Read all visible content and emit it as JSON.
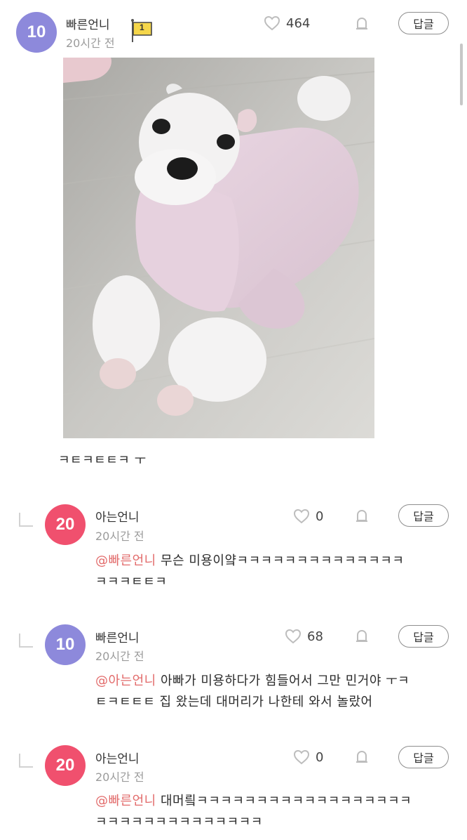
{
  "post": {
    "level": "10",
    "nickname": "빠른언니",
    "time": "20시간 전",
    "flag_badge": "1",
    "likes": "464",
    "reply_label": "답글",
    "text": "ㅋㅌㅋㅌㅌㅋ ㅜ"
  },
  "comments": [
    {
      "level": "20",
      "nickname": "아는언니",
      "time": "20시간 전",
      "likes": "0",
      "reply_label": "답글",
      "mention": "@빠른언니",
      "line1": " 무슨 미용이얔ㅋㅋㅋㅋㅋㅋㅋㅋㅋㅋㅋㅋㅋㅋ",
      "line2": "ㅋㅋㅋㅌㅌㅋ"
    },
    {
      "level": "10",
      "nickname": "빠른언니",
      "time": "20시간 전",
      "likes": "68",
      "reply_label": "답글",
      "mention": "@아는언니",
      "line1": " 아빠가 미용하다가 힘들어서 그만 민거야 ㅜㅋ",
      "line2": "ㅌㅋㅌㅌㅌ 집 왔는데 대머리가 나한테 와서 놀랐어"
    },
    {
      "level": "20",
      "nickname": "아는언니",
      "time": "20시간 전",
      "likes": "0",
      "reply_label": "답글",
      "mention": "@빠른언니",
      "line1": " 대머릨ㅋㅋㅋㅋㅋㅋㅋㅋㅋㅋㅋㅋㅋㅋㅋㅋㅋㅋ",
      "line2": "ㅋㅋㅋㅋㅋㅋㅋㅋㅋㅋㅋㅋㅋㅋ"
    }
  ],
  "colors": {
    "level10": "#8d89db",
    "level20": "#f0506e",
    "mention": "#e26a6a",
    "flag": "#f5d64a"
  },
  "icons": {
    "like": "heart-icon",
    "report": "bell-icon",
    "flag": "flag-icon",
    "indent": "reply-indent-icon"
  }
}
